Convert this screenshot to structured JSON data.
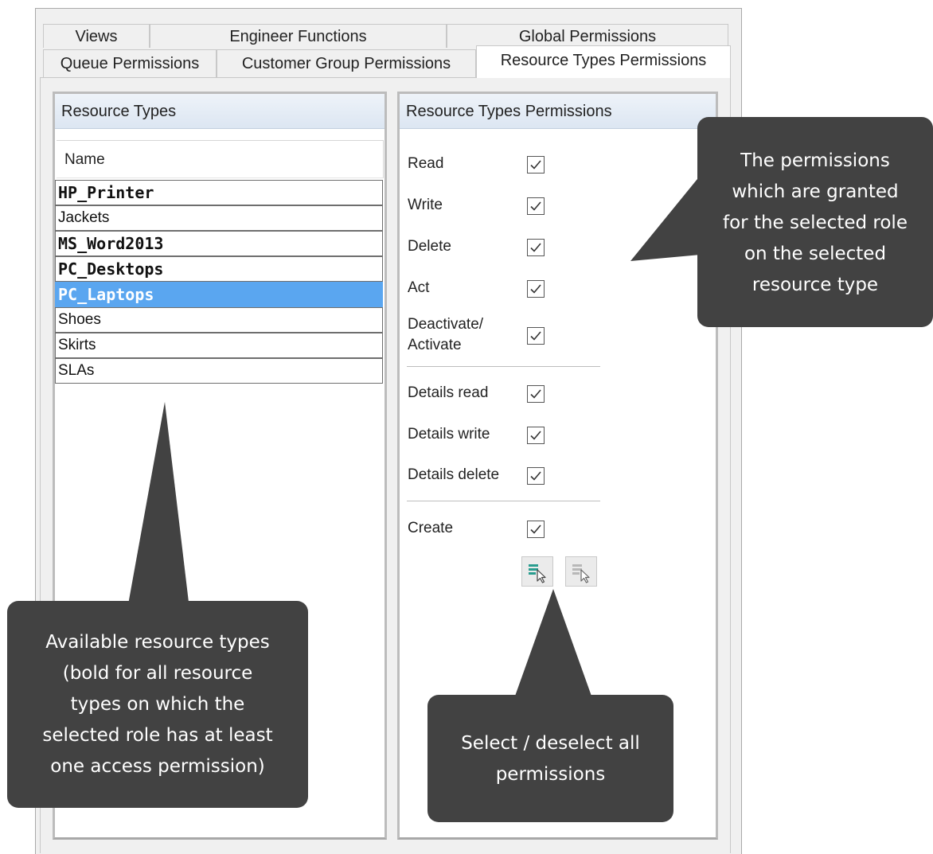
{
  "tabs": {
    "row1": [
      "Views",
      "Engineer Functions",
      "Global Permissions"
    ],
    "row2": [
      "Queue Permissions",
      "Customer Group Permissions",
      "Resource Types Permissions"
    ],
    "active": "Resource Types Permissions"
  },
  "resource_types": {
    "header": "Resource Types",
    "column": "Name",
    "items": [
      {
        "name": "HP_Printer",
        "bold": true,
        "selected": false
      },
      {
        "name": "Jackets",
        "bold": false,
        "selected": false
      },
      {
        "name": "MS_Word2013",
        "bold": true,
        "selected": false
      },
      {
        "name": "PC_Desktops",
        "bold": true,
        "selected": false
      },
      {
        "name": "PC_Laptops",
        "bold": true,
        "selected": true
      },
      {
        "name": "Shoes",
        "bold": false,
        "selected": false
      },
      {
        "name": "Skirts",
        "bold": false,
        "selected": false
      },
      {
        "name": "SLAs",
        "bold": false,
        "selected": false
      }
    ]
  },
  "permissions": {
    "header": "Resource Types Permissions",
    "items": [
      {
        "label_line1": "Read",
        "label_line2": "",
        "checked": true
      },
      {
        "label_line1": "Write",
        "label_line2": "",
        "checked": true
      },
      {
        "label_line1": "Delete",
        "label_line2": "",
        "checked": true
      },
      {
        "label_line1": "Act",
        "label_line2": "",
        "checked": true
      },
      {
        "label_line1": "Deactivate/",
        "label_line2": "Activate",
        "checked": true
      },
      {
        "label_line1": "Details read",
        "label_line2": "",
        "checked": true
      },
      {
        "label_line1": "Details write",
        "label_line2": "",
        "checked": true
      },
      {
        "label_line1": "Details delete",
        "label_line2": "",
        "checked": true
      },
      {
        "label_line1": "Create",
        "label_line2": "",
        "checked": true
      }
    ],
    "select_all_icon": "select-all-icon",
    "deselect_all_icon": "deselect-all-icon"
  },
  "callouts": {
    "permissions": [
      "The permissions",
      "which are granted",
      "for the selected role",
      "on the selected",
      "resource type"
    ],
    "resource_types": [
      "Available resource types",
      "(bold for all resource",
      "types on which the",
      "selected role has at least",
      "one access permission)"
    ],
    "select_buttons": [
      "Select / deselect all",
      "permissions"
    ]
  },
  "colors": {
    "callout_bg": "#424242",
    "selection": "#5aa6f0",
    "header_gradient_top": "#eef3f9",
    "header_gradient_bottom": "#dce6f2",
    "select_icon_accent": "#2a9d8f"
  }
}
